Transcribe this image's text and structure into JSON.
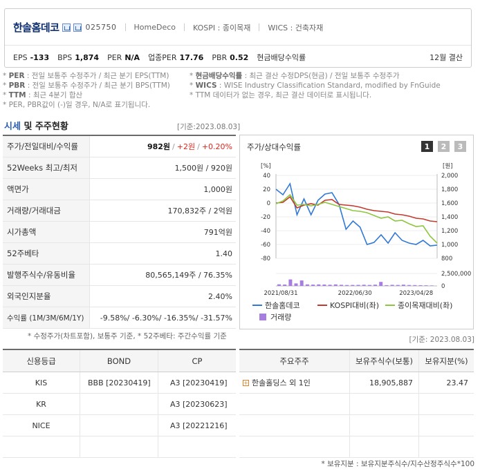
{
  "header": {
    "company": "한솔홈데코",
    "code": "025750",
    "tags": [
      "HomeDeco",
      "KOSPI : 종이목재",
      "WICS : 건축자재"
    ],
    "metrics": [
      {
        "label": "EPS",
        "value": "-133"
      },
      {
        "label": "BPS",
        "value": "1,874"
      },
      {
        "label": "PER",
        "value": "N/A"
      },
      {
        "label": "업종PER",
        "value": "17.76"
      },
      {
        "label": "PBR",
        "value": "0.52"
      },
      {
        "label": "현금배당수익률",
        "value": ""
      }
    ],
    "settle": "12월 결산"
  },
  "notes": {
    "l1_key": "PER",
    "l1_text": ": 전일 보통주 수정주가 / 최근 분기 EPS(TTM)",
    "l2_key": "PBR",
    "l2_text": ": 전일 보통주 수정주가 / 최근 분기 BPS(TTM)",
    "l3_key": "TTM",
    "l3_text": ": 최근 4분기 합산",
    "l4_text": "* PER, PBR값이 (-)일 경우, N/A로 표기됩니다.",
    "r1_key": "현금배당수익률",
    "r1_text": ": 최근 결산 수정DPS(현금) / 전일 보통주 수정주가",
    "r2_key": "WICS",
    "r2_text": ": WISE Industry Classification Standard, modified by FnGuide",
    "r3_text": "* TTM 데이터가 없는 경우, 최근 결산 데이터로 표시됩니다."
  },
  "section": {
    "title_a": "시세",
    "title_b": " 및 주주현황",
    "asof": "[기준:2023.08.03]"
  },
  "quote": {
    "rows": [
      {
        "label": "주가/전일대비/수익률"
      },
      {
        "label": "52Weeks 최고/최저",
        "value": "1,500원 / 920원"
      },
      {
        "label": "액면가",
        "value": "1,000원"
      },
      {
        "label": "거래량/거래대금",
        "value": "170,832주 / 2억원"
      },
      {
        "label": "시가총액",
        "value": "791억원"
      },
      {
        "label": "52주베타",
        "value": "1.40"
      },
      {
        "label": "발행주식수/유동비율",
        "value": "80,565,149주 / 76.35%"
      },
      {
        "label": "외국인지분율",
        "value": "2.40%"
      },
      {
        "label": "수익률 (1M/3M/6M/1Y)"
      }
    ],
    "price": "982원",
    "change": "+2원",
    "change_pct": "+0.20%",
    "returns": "-9.58%/ -6.30%/ -16.35%/ -31.57%",
    "note": "* 수정주가(차트포함), 보통주 기준, * 52주베타: 주간수익률 기준"
  },
  "chart": {
    "title": "주가/상대수익률",
    "pages": [
      "1",
      "2",
      "3"
    ],
    "unit_left": "[%]",
    "unit_right": "[원]",
    "vol_tick": "2,500,000",
    "vol_zero": "0"
  },
  "chart_data": {
    "type": "line",
    "x_ticks": [
      "2021/08/31",
      "2022/06/30",
      "2023/04/28"
    ],
    "y_left_ticks": [
      "40",
      "20",
      "0",
      "-20",
      "-40",
      "-60",
      "-80"
    ],
    "y_right_ticks": [
      "2,000",
      "1,800",
      "1,600",
      "1,400",
      "1,200",
      "1,000",
      "800"
    ],
    "ylim_left": [
      -80,
      40
    ],
    "ylim_right": [
      800,
      2000
    ],
    "series": [
      {
        "name": "한솔홈데코",
        "color": "#2f78d6",
        "axis": "right",
        "values": [
          1800,
          1720,
          1880,
          1430,
          1660,
          1430,
          1640,
          1730,
          1750,
          1580,
          1220,
          1340,
          1250,
          1000,
          1030,
          1140,
          1020,
          1170,
          1060,
          1020,
          1000,
          1060,
          980,
          990
        ]
      },
      {
        "name": "KOSPI대비(좌)",
        "color": "#c0392b",
        "axis": "left",
        "values": [
          0,
          1,
          9,
          -7,
          -3,
          -1,
          -3,
          4,
          5,
          -2,
          -3,
          -4,
          -6,
          -9,
          -11,
          -12,
          -13,
          -16,
          -17,
          -19,
          -22,
          -23,
          -26,
          -27
        ]
      },
      {
        "name": "종이목재대비(좌)",
        "color": "#8dc63f",
        "axis": "left",
        "values": [
          -1,
          3,
          12,
          -3,
          -2,
          -4,
          -2,
          1,
          -2,
          -5,
          -8,
          -11,
          -12,
          -14,
          -18,
          -22,
          -20,
          -26,
          -25,
          -30,
          -34,
          -33,
          -48,
          -58
        ]
      },
      {
        "name": "거래량",
        "color": "#a77de0",
        "axis": "volume",
        "values": [
          320000,
          280000,
          1300000,
          500000,
          1100000,
          300000,
          260000,
          300000,
          280000,
          240000,
          300000,
          220000,
          180000,
          200000,
          210000,
          230000,
          200000,
          250000,
          800000,
          150000,
          220000,
          200000,
          250000,
          180000,
          160000,
          140000,
          120000,
          100000
        ]
      }
    ]
  },
  "credit": {
    "headers": [
      "신용등급",
      "BOND",
      "CP"
    ],
    "rows": [
      [
        "KIS",
        "BBB [20230419]",
        "A3 [20230419]"
      ],
      [
        "KR",
        "",
        "A3 [20230623]"
      ],
      [
        "NICE",
        "",
        "A3 [20221216]"
      ]
    ]
  },
  "holders": {
    "asof": "[기준: 2023.08.03]",
    "headers": [
      "주요주주",
      "보유주식수(보통)",
      "보유지분(%)"
    ],
    "rows": [
      [
        "한솔홀딩스 외 1인",
        "18,905,887",
        "23.47"
      ]
    ],
    "footnote": "* 보유지분 : 보유지분주식수/지수산정주식수*100"
  }
}
